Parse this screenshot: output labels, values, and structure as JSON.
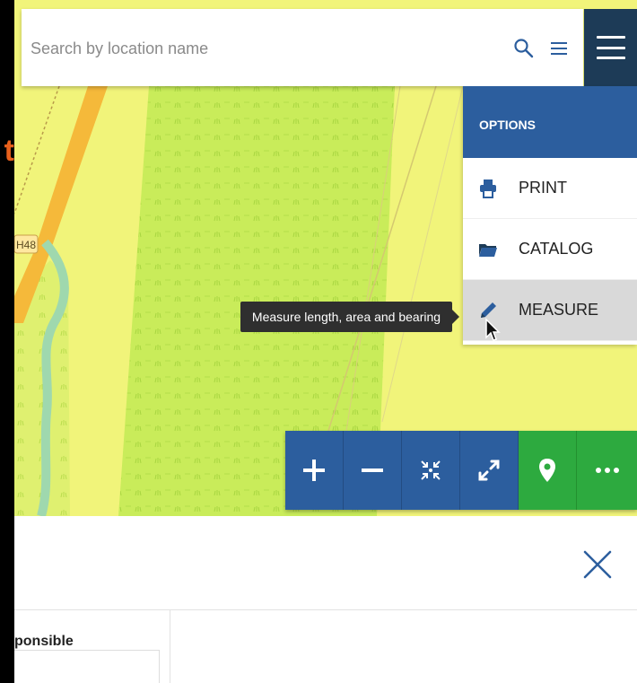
{
  "search": {
    "placeholder": "Search by location name",
    "value": ""
  },
  "options": {
    "header": "OPTIONS",
    "items": [
      {
        "label": "PRINT",
        "icon": "printer-icon"
      },
      {
        "label": "CATALOG",
        "icon": "folder-icon"
      },
      {
        "label": "MEASURE",
        "icon": "ruler-pencil-icon",
        "active": true
      }
    ]
  },
  "tooltip": {
    "text": "Measure length, area and bearing"
  },
  "map": {
    "road_label": "H48"
  },
  "controls": [
    {
      "name": "zoom-in-button",
      "icon": "plus-icon"
    },
    {
      "name": "zoom-out-button",
      "icon": "minus-icon"
    },
    {
      "name": "zoom-extent-button",
      "icon": "compress-arrows-icon"
    },
    {
      "name": "fullscreen-button",
      "icon": "expand-arrows-icon"
    },
    {
      "name": "locate-button",
      "icon": "map-pin-icon"
    },
    {
      "name": "more-button",
      "icon": "ellipsis-icon"
    }
  ],
  "bottom": {
    "column_header": "ponsible"
  },
  "colors": {
    "map_background": "#f1f47a",
    "vegetation": "#c9ec5a",
    "nav_dark": "#1d3b57",
    "primary_blue": "#2c5e9e",
    "accent_green": "#2daa3f",
    "road_orange": "#f5b93a",
    "river": "#9fd8ae"
  }
}
